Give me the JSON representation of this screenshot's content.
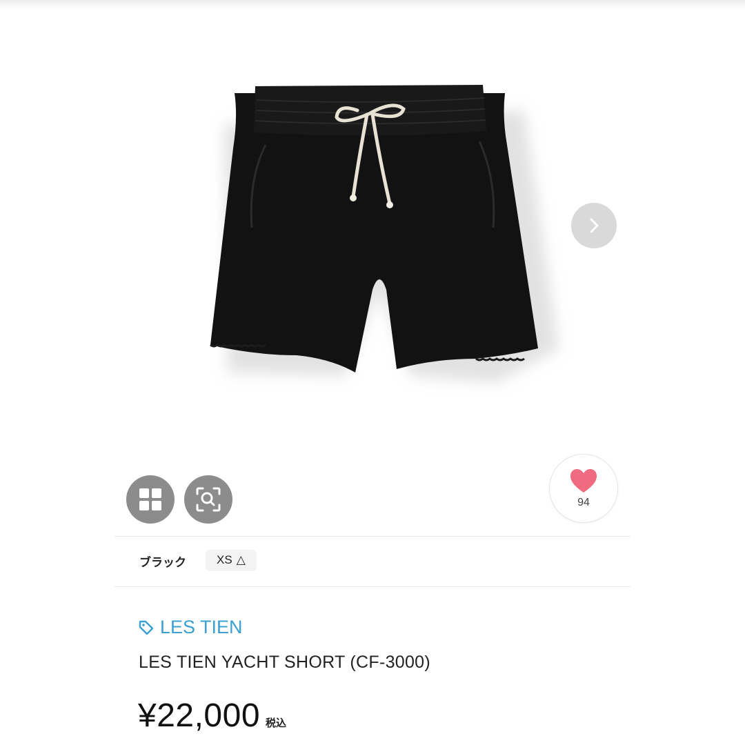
{
  "product": {
    "name": "LES TIEN YACHT SHORT (CF-3000)",
    "brand": "LES TIEN",
    "price": "¥22,000",
    "tax_label": "税込",
    "image": "black-drawstring-shorts"
  },
  "gallery": {
    "next_icon": "chevron-right-icon"
  },
  "actions": {
    "grid_icon": "grid-icon",
    "scan_icon": "image-search-icon",
    "like_icon": "heart-icon",
    "like_count": "94"
  },
  "variant": {
    "color": "ブラック",
    "size": "XS",
    "stock_mark": "△"
  },
  "colors": {
    "brand_link": "#3a9fd1",
    "heart": "#f06b80",
    "action_button": "#8c8c8c"
  }
}
